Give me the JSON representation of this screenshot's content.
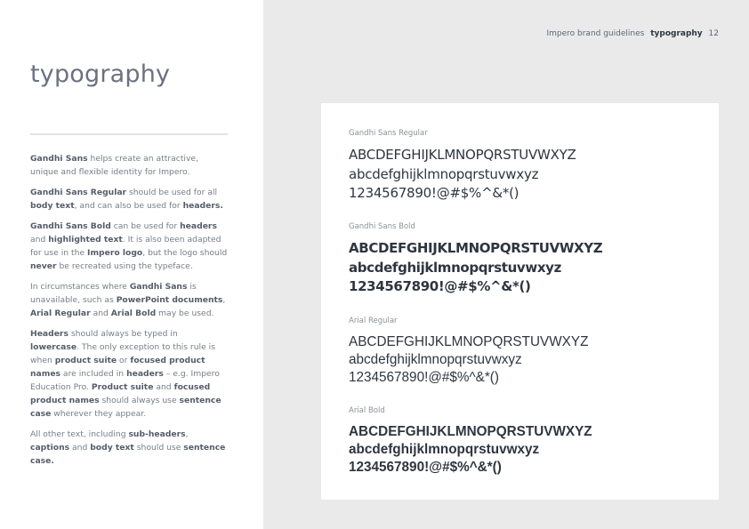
{
  "header": {
    "doc_title": "Impero brand guidelines",
    "section": "typography",
    "page_number": "12"
  },
  "page_title": "typography",
  "intro": {
    "paragraphs": [
      [
        {
          "t": "Gandhi Sans",
          "b": true
        },
        {
          "t": " helps create an attractive, unique and flexible identity for Impero."
        }
      ],
      [
        {
          "t": "Gandhi Sans Regular",
          "b": true
        },
        {
          "t": " should be used for all "
        },
        {
          "t": "body text",
          "b": true
        },
        {
          "t": ", and can also be used for "
        },
        {
          "t": "headers.",
          "b": true
        }
      ],
      [
        {
          "t": "Gandhi Sans Bold",
          "b": true
        },
        {
          "t": " can be used for "
        },
        {
          "t": "headers",
          "b": true
        },
        {
          "t": " and "
        },
        {
          "t": "highlighted text",
          "b": true
        },
        {
          "t": ". It is also been adapted for use in the "
        },
        {
          "t": "Impero logo",
          "b": true
        },
        {
          "t": ", but the logo should "
        },
        {
          "t": "never",
          "b": true
        },
        {
          "t": " be recreated using the typeface."
        }
      ],
      [
        {
          "t": "In circumstances where "
        },
        {
          "t": "Gandhi Sans",
          "b": true
        },
        {
          "t": " is unavailable, such as "
        },
        {
          "t": "PowerPoint documents",
          "b": true
        },
        {
          "t": ", "
        },
        {
          "t": "Arial Regular",
          "b": true
        },
        {
          "t": " and "
        },
        {
          "t": "Arial Bold",
          "b": true
        },
        {
          "t": " may be used."
        }
      ],
      [
        {
          "t": "Headers",
          "b": true
        },
        {
          "t": " should always be typed in "
        },
        {
          "t": "lowercase",
          "b": true
        },
        {
          "t": ". The only exception to this rule is when "
        },
        {
          "t": "product suite",
          "b": true
        },
        {
          "t": " or "
        },
        {
          "t": "focused product names",
          "b": true
        },
        {
          "t": " are included in "
        },
        {
          "t": "headers",
          "b": true
        },
        {
          "t": " – e.g. Impero Education Pro. "
        },
        {
          "t": "Product suite",
          "b": true
        },
        {
          "t": " and "
        },
        {
          "t": "focused product names",
          "b": true
        },
        {
          "t": " should always use "
        },
        {
          "t": "sentence case",
          "b": true
        },
        {
          "t": " wherever they appear."
        }
      ],
      [
        {
          "t": "All other text, including "
        },
        {
          "t": "sub-headers",
          "b": true
        },
        {
          "t": ", "
        },
        {
          "t": "captions",
          "b": true
        },
        {
          "t": " and "
        },
        {
          "t": "body text",
          "b": true
        },
        {
          "t": " should use "
        },
        {
          "t": "sentence case.",
          "b": true
        }
      ]
    ]
  },
  "specimens": [
    {
      "label": "Gandhi Sans Regular",
      "lines": [
        "ABCDEFGHIJKLMNOPQRSTUVWXYZ",
        "abcdefghijklmnopqrstuvwxyz",
        "1234567890!@#$%^&*()"
      ]
    },
    {
      "label": "Gandhi Sans Bold",
      "lines": [
        "ABCDEFGHIJKLMNOPQRSTUVWXYZ",
        "abcdefghijklmnopqrstuvwxyz",
        "1234567890!@#$%^&*()"
      ]
    },
    {
      "label": "Arial Regular",
      "lines": [
        "ABCDEFGHIJKLMNOPQRSTUVWXYZ",
        "abcdefghijklmnopqrstuvwxyz",
        "1234567890!@#$%^&*()"
      ]
    },
    {
      "label": "Arial Bold",
      "lines": [
        "ABCDEFGHIJKLMNOPQRSTUVWXYZ",
        "abcdefghijklmnopqrstuvwxyz",
        "1234567890!@#$%^&*()"
      ]
    }
  ]
}
